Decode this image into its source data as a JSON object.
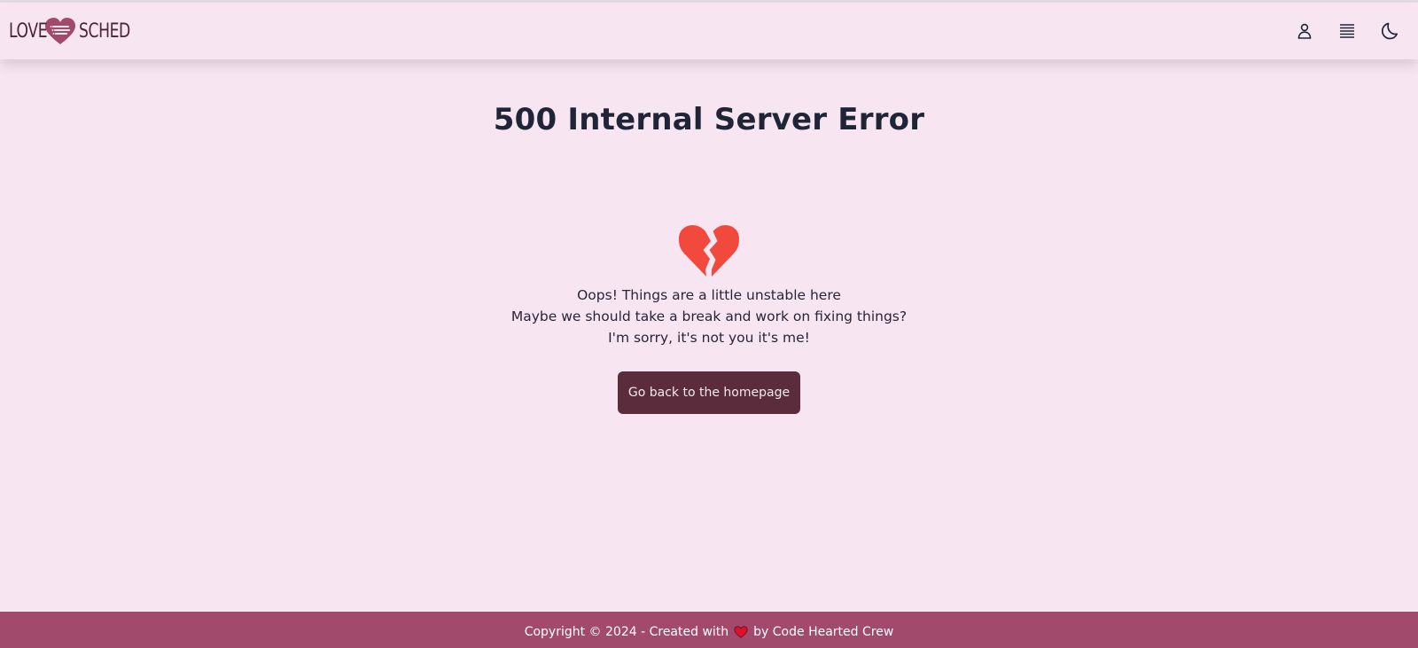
{
  "brand": {
    "word_left": "LOVE",
    "word_right": "SCHED",
    "logo_color": "#a14a6b",
    "text_color": "#4a2535"
  },
  "nav": {
    "icons": [
      "user-icon",
      "menu-lines-icon",
      "moon-icon"
    ]
  },
  "main": {
    "title": "500 Internal Server Error",
    "icon": "broken-heart-icon",
    "icon_color": "#f2493d",
    "messages": [
      "Oops! Things are a little unstable here",
      "Maybe we should take a break and work on fixing things?",
      "I'm sorry, it's not you it's me!"
    ],
    "button_label": "Go back to the homepage",
    "button_color": "#5b2c3b"
  },
  "footer": {
    "text_before": "Copyright © 2024 - Created with",
    "text_after": "by Code Hearted Crew",
    "heart_icon": "heart-icon",
    "heart_color": "#e0102b",
    "background": "#a14a6b"
  },
  "colors": {
    "page_background": "#f7e6f1",
    "title_color": "#1f2537"
  }
}
